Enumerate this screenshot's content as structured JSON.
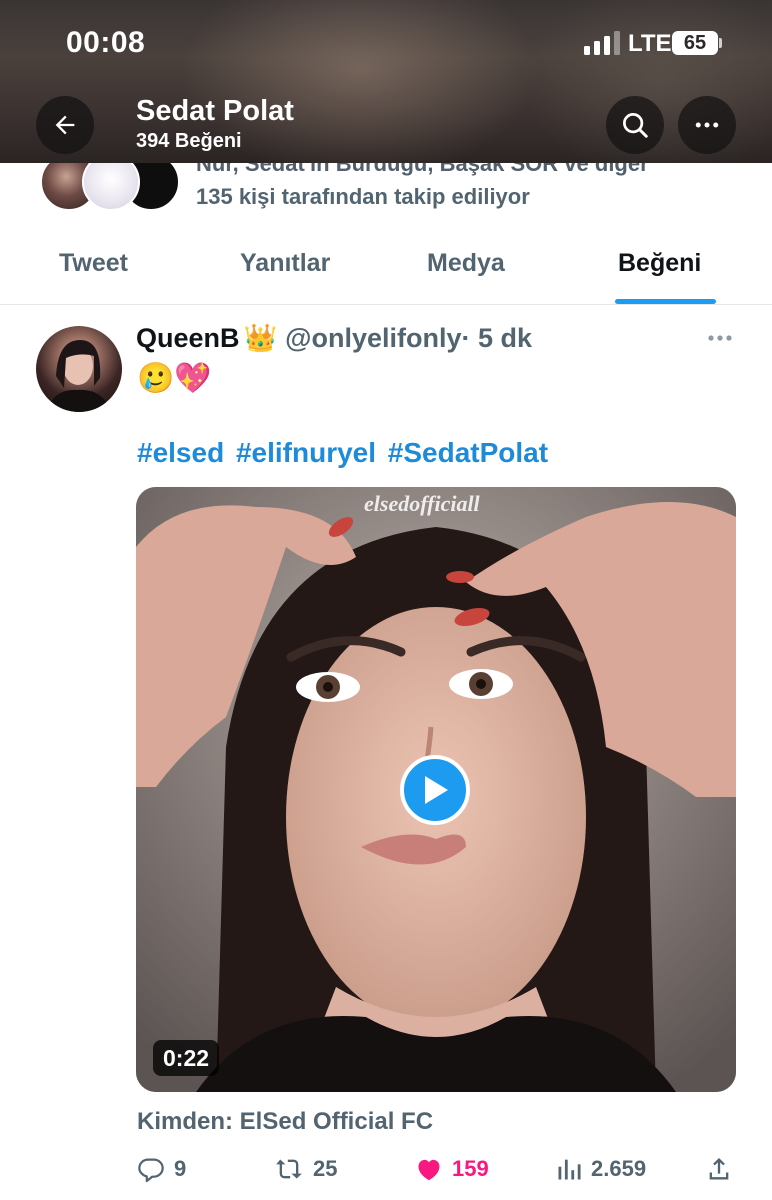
{
  "status_bar": {
    "time": "00:08",
    "network": "LTE",
    "battery": "65"
  },
  "header": {
    "name": "Sedat Polat",
    "likes_count": "394 Beğeni"
  },
  "followers": {
    "truncated_line": "Nur, Sedat'ın Burdugu, Başak SOR ve diğer",
    "text": "135 kişi tarafından takip ediliyor"
  },
  "tabs": [
    "Tweet",
    "Yanıtlar",
    "Medya",
    "Beğeni"
  ],
  "active_tab": "Beğeni",
  "tweet": {
    "author": "QueenB",
    "crown": "👑",
    "handle": "@onlyelifonly",
    "time": "· 5 dk",
    "emojis": "🥲💖",
    "hashtags": [
      "#elsed",
      "#elifnuryel",
      "#SedatPolat"
    ],
    "video": {
      "watermark": "elsedofficiall",
      "duration": "0:22"
    },
    "source": "Kimden: ElSed Official FC",
    "actions": {
      "replies": "9",
      "retweets": "25",
      "likes": "159",
      "views": "2.659"
    }
  },
  "colors": {
    "accent": "#1d9bf0",
    "like": "#f91880",
    "secondary_text": "#536471"
  }
}
